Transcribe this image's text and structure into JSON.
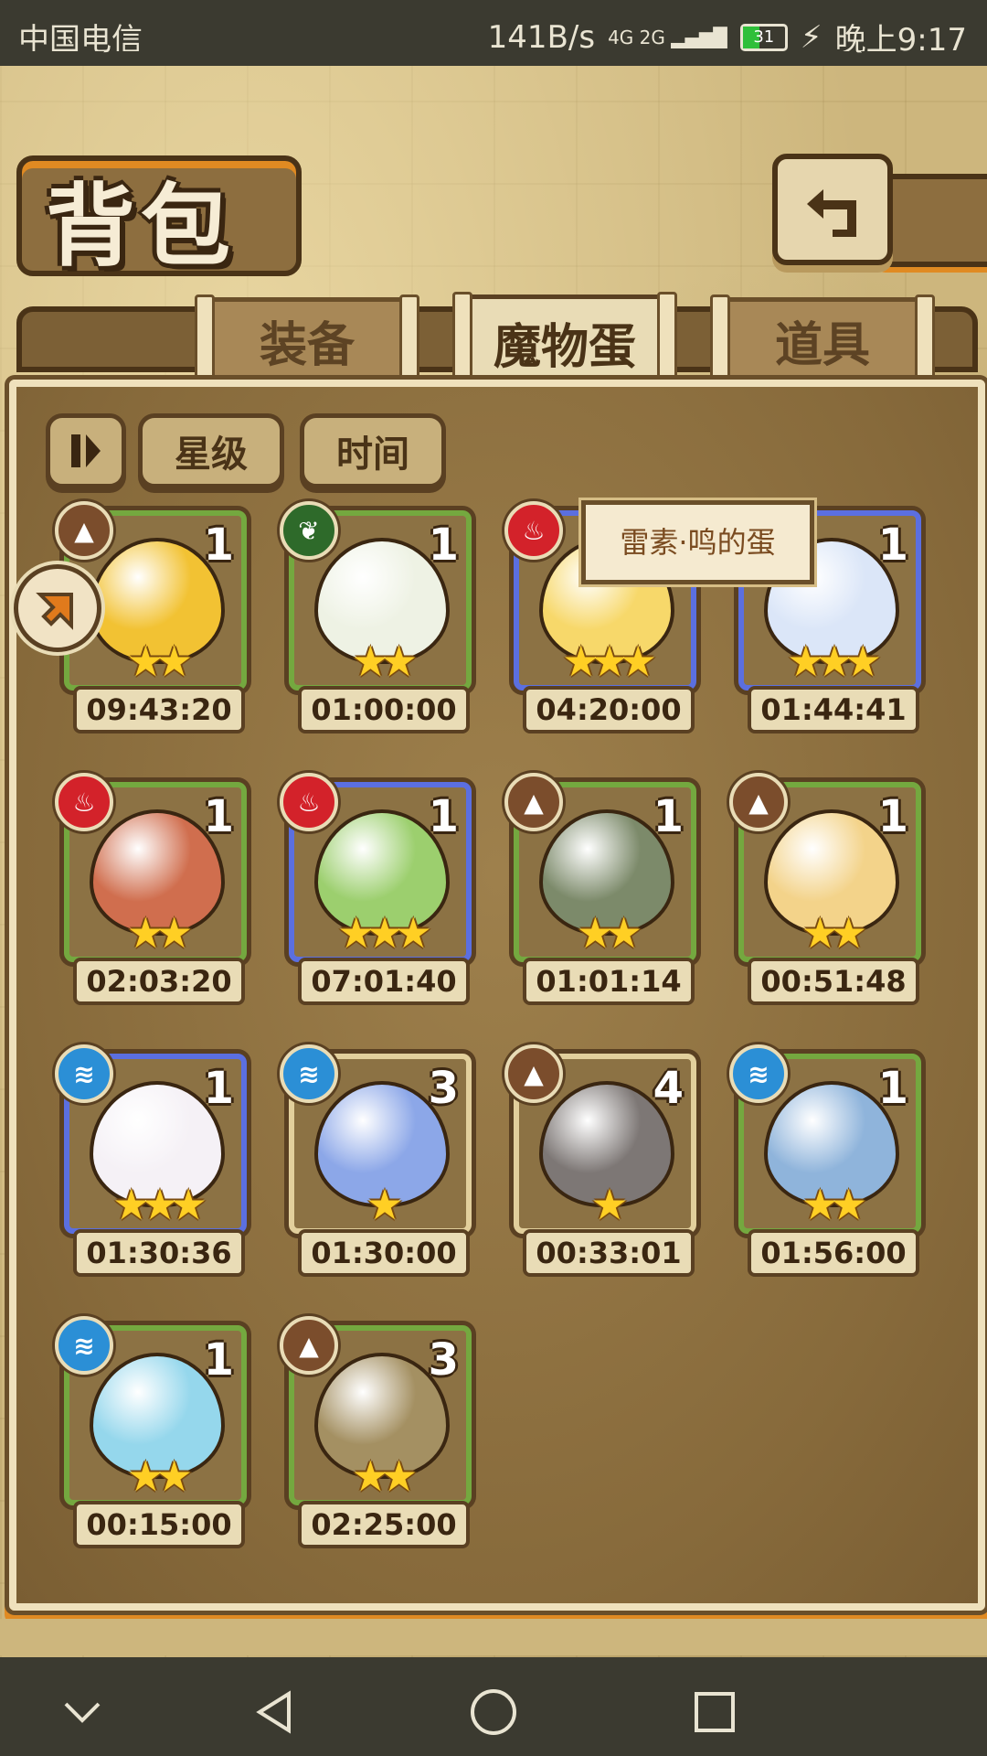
{
  "status_bar": {
    "carrier": "中国电信",
    "speed": "141B/s",
    "network": "4G 2G",
    "battery": "31",
    "time": "晚上9:17"
  },
  "header": {
    "title": "背包",
    "back_icon": "return-arrow-icon"
  },
  "tabs": [
    {
      "label": "装备",
      "active": false
    },
    {
      "label": "魔物蛋",
      "active": true
    },
    {
      "label": "道具",
      "active": false
    }
  ],
  "sort": {
    "toggle_icon": "pause-sort-icon",
    "star_label": "星级",
    "time_label": "时间"
  },
  "tooltip": "雷素·鸣的蛋",
  "eggs": [
    {
      "element": "earth",
      "count": "1",
      "stars": "★★",
      "timer": "09:43:20",
      "frame": "green",
      "color": "#f2c233"
    },
    {
      "element": "plant",
      "count": "1",
      "stars": "★★",
      "timer": "01:00:00",
      "frame": "green",
      "color": "#eef2e4"
    },
    {
      "element": "fire",
      "count": "",
      "stars": "★★★",
      "timer": "04:20:00",
      "frame": "blue",
      "color": "#f7d86a"
    },
    {
      "element": "water",
      "count": "1",
      "stars": "★★★",
      "timer": "01:44:41",
      "frame": "blue",
      "color": "#dbe6f8"
    },
    {
      "element": "fire",
      "count": "1",
      "stars": "★★",
      "timer": "02:03:20",
      "frame": "green",
      "color": "#d06e4e"
    },
    {
      "element": "fire",
      "count": "1",
      "stars": "★★★",
      "timer": "07:01:40",
      "frame": "blue",
      "color": "#9ccf6e"
    },
    {
      "element": "earth",
      "count": "1",
      "stars": "★★",
      "timer": "01:01:14",
      "frame": "green",
      "color": "#7c8a6a"
    },
    {
      "element": "earth",
      "count": "1",
      "stars": "★★",
      "timer": "00:51:48",
      "frame": "green",
      "color": "#f3d38a"
    },
    {
      "element": "water",
      "count": "1",
      "stars": "★★★",
      "timer": "01:30:36",
      "frame": "blue",
      "color": "#f5f1f6"
    },
    {
      "element": "water",
      "count": "3",
      "stars": "★",
      "timer": "01:30:00",
      "frame": "tan",
      "color": "#8ca7e8"
    },
    {
      "element": "earth",
      "count": "4",
      "stars": "★",
      "timer": "00:33:01",
      "frame": "tan",
      "color": "#7d7775"
    },
    {
      "element": "water",
      "count": "1",
      "stars": "★★",
      "timer": "01:56:00",
      "frame": "green",
      "color": "#8fb4db"
    },
    {
      "element": "water",
      "count": "1",
      "stars": "★★",
      "timer": "00:15:00",
      "frame": "green",
      "color": "#95d7ec"
    },
    {
      "element": "earth",
      "count": "3",
      "stars": "★★",
      "timer": "02:25:00",
      "frame": "green",
      "color": "#a49062"
    }
  ],
  "element_icons": {
    "earth": "mountain-icon",
    "plant": "leaf-icon",
    "fire": "flame-icon",
    "water": "waves-icon"
  },
  "navbar": {
    "icons": [
      "chevron-down-icon",
      "back-triangle-icon",
      "home-circle-icon",
      "recents-square-icon"
    ]
  }
}
